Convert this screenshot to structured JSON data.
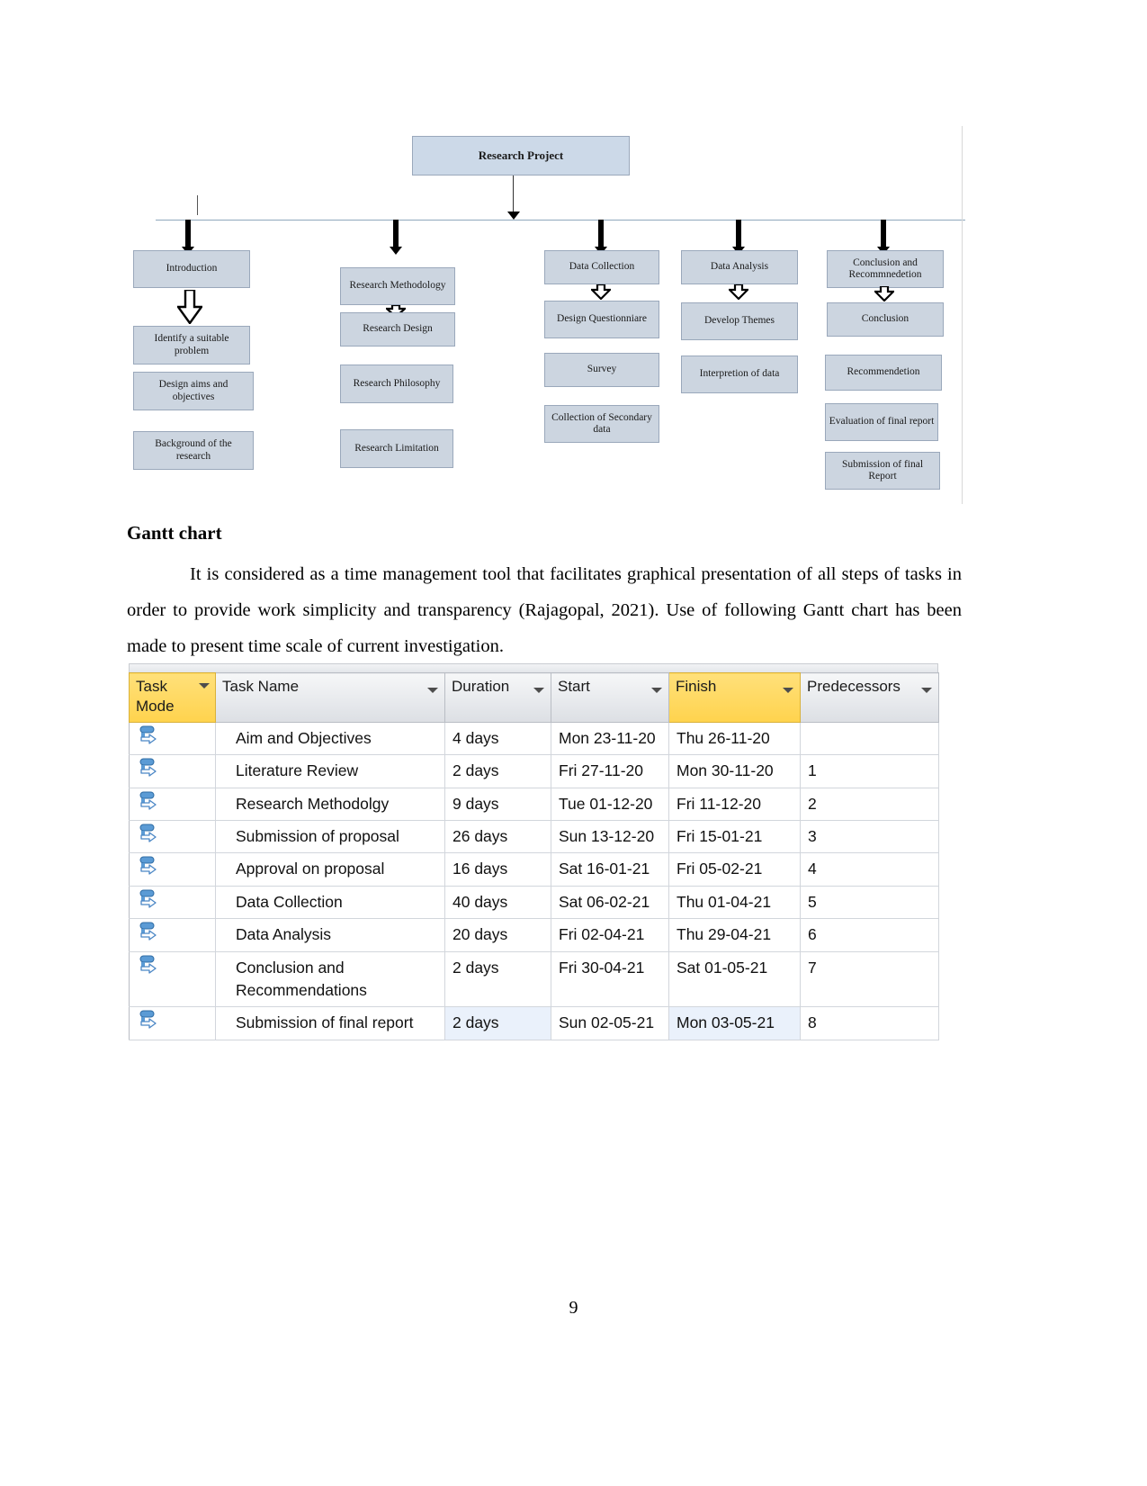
{
  "document": {
    "page_number": "9",
    "heading": "Gantt chart",
    "paragraph": "It is considered as a time management tool that facilitates graphical presentation of all steps of tasks in order to provide work simplicity and transparency (Rajagopal, 2021). Use of following Gantt chart has been made to present time scale of current investigation."
  },
  "diagram": {
    "root": "Research Project",
    "branches": [
      {
        "title": "Introduction",
        "children": [
          "Identify a suitable problem",
          "Design aims and objectives",
          "Background of the research"
        ]
      },
      {
        "title": "Research Methodology",
        "children": [
          "Research Design",
          "Research Philosophy",
          "Research Limitation"
        ]
      },
      {
        "title": "Data Collection",
        "children": [
          "Design Questionniare",
          "Survey",
          "Collection of Secondary data"
        ]
      },
      {
        "title": "Data Analysis",
        "children": [
          "Develop Themes",
          "Interpretion of data"
        ]
      },
      {
        "title": "Conclusion and Recommnedetion",
        "children": [
          "Conclusion",
          "Recommendetion",
          "Evaluation of final report",
          "Submission of final Report"
        ]
      }
    ],
    "box_fill": "#ccd5e0",
    "box_border": "#9aa8bb"
  },
  "gantt": {
    "columns": [
      {
        "label": "Task Mode",
        "highlighted": true
      },
      {
        "label": "Task Name",
        "highlighted": false
      },
      {
        "label": "Duration",
        "highlighted": false
      },
      {
        "label": "Start",
        "highlighted": false
      },
      {
        "label": "Finish",
        "highlighted": true
      },
      {
        "label": "Predecessors",
        "highlighted": false
      }
    ],
    "header_highlight_color": "#ffd34d",
    "selected_row_color": "#eaf1fb",
    "task_mode_icon": "auto-scheduled-icon",
    "rows": [
      {
        "name": "Aim and Objectives",
        "duration": "4 days",
        "start": "Mon 23-11-20",
        "finish": "Thu 26-11-20",
        "predecessors": "",
        "selected": false
      },
      {
        "name": "Literature Review",
        "duration": "2 days",
        "start": "Fri 27-11-20",
        "finish": "Mon 30-11-20",
        "predecessors": "1",
        "selected": false
      },
      {
        "name": "Research Methodolgy",
        "duration": "9 days",
        "start": "Tue 01-12-20",
        "finish": "Fri 11-12-20",
        "predecessors": "2",
        "selected": false
      },
      {
        "name": "Submission of proposal",
        "duration": "26 days",
        "start": "Sun 13-12-20",
        "finish": "Fri 15-01-21",
        "predecessors": "3",
        "selected": false
      },
      {
        "name": "Approval on proposal",
        "duration": "16 days",
        "start": "Sat 16-01-21",
        "finish": "Fri 05-02-21",
        "predecessors": "4",
        "selected": false
      },
      {
        "name": "Data Collection",
        "duration": "40 days",
        "start": "Sat 06-02-21",
        "finish": "Thu 01-04-21",
        "predecessors": "5",
        "selected": false
      },
      {
        "name": "Data Analysis",
        "duration": "20 days",
        "start": "Fri 02-04-21",
        "finish": "Thu 29-04-21",
        "predecessors": "6",
        "selected": false
      },
      {
        "name": "Conclusion and Recommendations",
        "duration": "2 days",
        "start": "Fri 30-04-21",
        "finish": "Sat 01-05-21",
        "predecessors": "7",
        "selected": false
      },
      {
        "name": "Submission of final report",
        "duration": "2 days",
        "start": "Sun 02-05-21",
        "finish": "Mon 03-05-21",
        "predecessors": "8",
        "selected": true
      }
    ]
  }
}
